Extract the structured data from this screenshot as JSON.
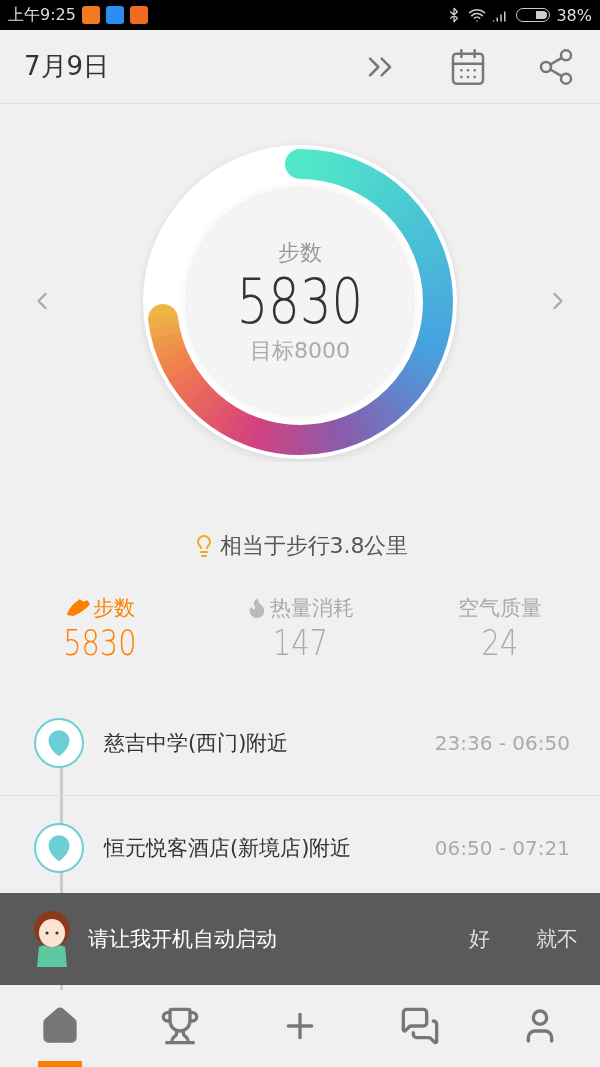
{
  "status_bar": {
    "time": "上午9:25",
    "battery": "38%"
  },
  "header": {
    "date": "7月9日"
  },
  "ring": {
    "label": "步数",
    "value": "5830",
    "goal": "目标8000",
    "level": 0.73
  },
  "tip": "相当于步行3.8公里",
  "stats": [
    {
      "kind": "steps",
      "label": "步数",
      "value": "5830",
      "selected": true
    },
    {
      "kind": "calories",
      "label": "热量消耗",
      "value": "147",
      "selected": false
    },
    {
      "kind": "air",
      "label": "空气质量",
      "value": "24",
      "selected": false
    }
  ],
  "timeline": [
    {
      "place": "慈吉中学(西门)附近",
      "time": "23:36 - 06:50"
    },
    {
      "place": "恒元悦客酒店(新境店)附近",
      "time": "06:50 - 07:21"
    }
  ],
  "banner": {
    "message": "请让我开机自动启动",
    "buttons": [
      "好",
      "就不"
    ]
  },
  "nav": [
    {
      "kind": "home",
      "selected": true
    },
    {
      "kind": "trophy",
      "selected": false
    },
    {
      "kind": "add",
      "selected": false
    },
    {
      "kind": "chat",
      "selected": false
    },
    {
      "kind": "profile",
      "selected": false
    }
  ]
}
